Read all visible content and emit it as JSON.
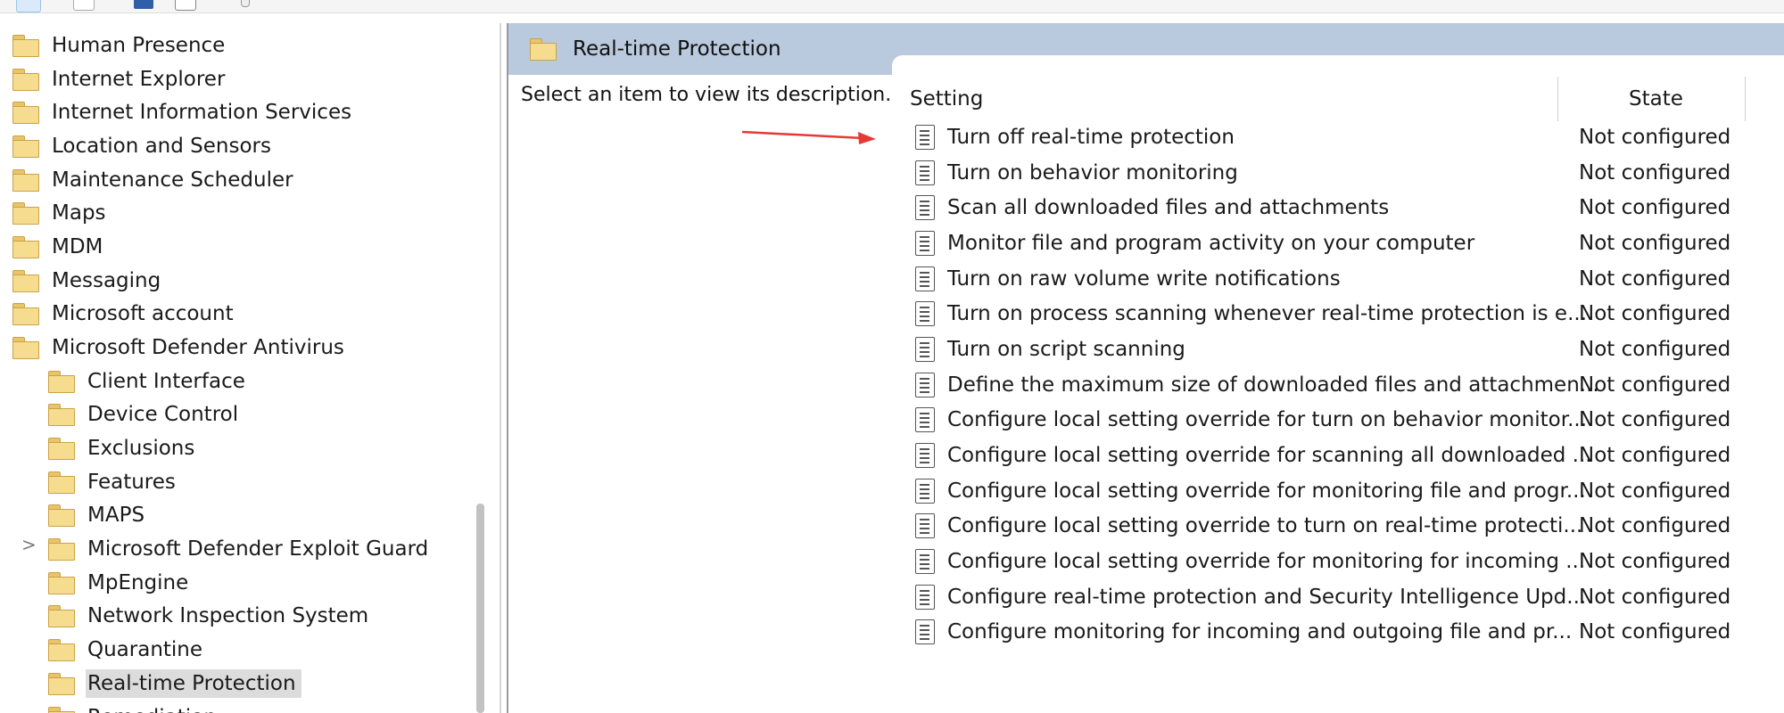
{
  "tree": {
    "items": [
      {
        "label": "Human Presence"
      },
      {
        "label": "Internet Explorer"
      },
      {
        "label": "Internet Information Services"
      },
      {
        "label": "Location and Sensors"
      },
      {
        "label": "Maintenance Scheduler"
      },
      {
        "label": "Maps"
      },
      {
        "label": "MDM"
      },
      {
        "label": "Messaging"
      },
      {
        "label": "Microsoft account"
      },
      {
        "label": "Microsoft Defender Antivirus"
      },
      {
        "label": "Client Interface"
      },
      {
        "label": "Device Control"
      },
      {
        "label": "Exclusions"
      },
      {
        "label": "Features"
      },
      {
        "label": "MAPS"
      },
      {
        "label": "Microsoft Defender Exploit Guard",
        "expander": ">"
      },
      {
        "label": "MpEngine"
      },
      {
        "label": "Network Inspection System"
      },
      {
        "label": "Quarantine"
      },
      {
        "label": "Real-time Protection"
      },
      {
        "label": "Remediation"
      }
    ]
  },
  "main": {
    "header_title": "Real-time Protection",
    "description_prompt": "Select an item to view its description.",
    "columns": {
      "setting": "Setting",
      "state": "State"
    },
    "rows": [
      {
        "name": "Turn off real-time protection",
        "state": "Not configured"
      },
      {
        "name": "Turn on behavior monitoring",
        "state": "Not configured"
      },
      {
        "name": "Scan all downloaded files and attachments",
        "state": "Not configured"
      },
      {
        "name": "Monitor file and program activity on your computer",
        "state": "Not configured"
      },
      {
        "name": "Turn on raw volume write notifications",
        "state": "Not configured"
      },
      {
        "name": "Turn on process scanning whenever real-time protection is e...",
        "state": "Not configured"
      },
      {
        "name": "Turn on script scanning",
        "state": "Not configured"
      },
      {
        "name": "Define the maximum size of downloaded files and attachmen...",
        "state": "Not configured"
      },
      {
        "name": "Configure local setting override for turn on behavior monitor...",
        "state": "Not configured"
      },
      {
        "name": "Configure local setting override for scanning all downloaded ...",
        "state": "Not configured"
      },
      {
        "name": "Configure local setting override for monitoring file and progr...",
        "state": "Not configured"
      },
      {
        "name": "Configure local setting override to turn on real-time protecti...",
        "state": "Not configured"
      },
      {
        "name": "Configure local setting override for monitoring for incoming ...",
        "state": "Not configured"
      },
      {
        "name": "Configure real-time protection and Security Intelligence Upd...",
        "state": "Not configured"
      },
      {
        "name": "Configure monitoring for incoming and outgoing file and pr...",
        "state": "Not configured"
      }
    ]
  },
  "colors": {
    "header_band": "#b9c9de",
    "selected": "#dcdcdc",
    "arrow": "#e53935"
  }
}
